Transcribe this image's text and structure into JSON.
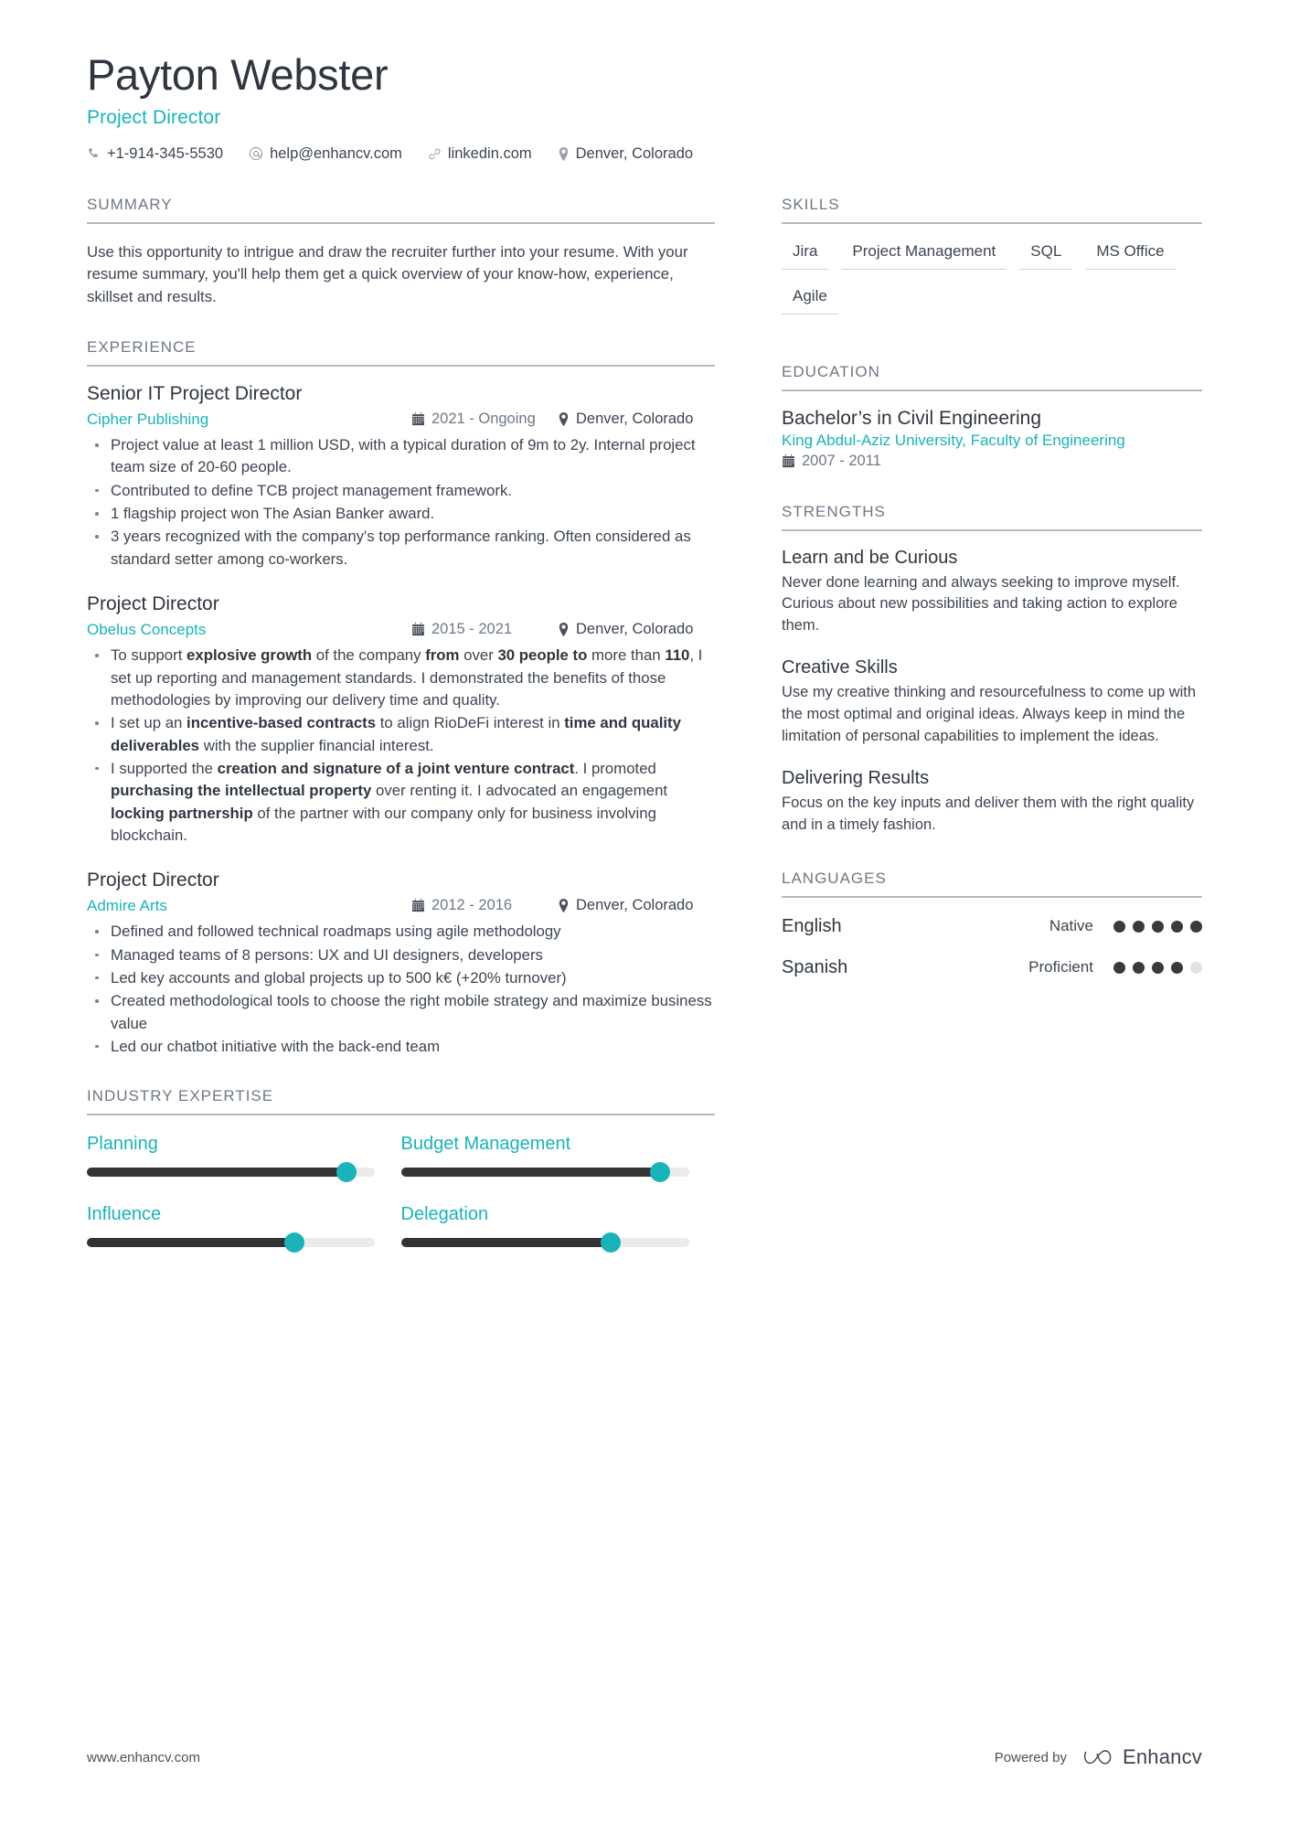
{
  "theme": {
    "accent": "#19b4b9",
    "dark": "#333333",
    "track": "#ebebe9",
    "rule": "#b6b9bd"
  },
  "header": {
    "name": "Payton Webster",
    "role": "Project Director",
    "contacts": [
      {
        "icon": "phone-icon",
        "text": "+1-914-345-5530"
      },
      {
        "icon": "email-icon",
        "text": "help@enhancv.com"
      },
      {
        "icon": "link-icon",
        "text": "linkedin.com"
      },
      {
        "icon": "location-icon",
        "text": "Denver, Colorado"
      }
    ]
  },
  "summary": {
    "heading": "SUMMARY",
    "text": "Use this opportunity to intrigue and draw the recruiter further into your resume. With your resume summary, you'll help them get a quick overview of your know-how, experience, skillset and results."
  },
  "experience": {
    "heading": "EXPERIENCE",
    "items": [
      {
        "title": "Senior IT Project Director",
        "company": "Cipher Publishing",
        "date": "2021 - Ongoing",
        "location": "Denver, Colorado",
        "bullets": [
          "Project value at least 1 million USD, with a typical duration of 9m to 2y. Internal project team size of 20-60 people.",
          "Contributed to define TCB project management framework.",
          "1 flagship project won The Asian Banker award.",
          "3 years recognized with the company's top performance ranking. Often considered as standard setter among co-workers."
        ]
      },
      {
        "title": "Project Director",
        "company": "Obelus Concepts",
        "date": "2015 - 2021",
        "location": "Denver, Colorado",
        "bullets_html": [
          "To support <b>explosive growth</b> of the company <b>from</b> over <b>30 people to</b> more than <b>110</b>, I set up reporting and management standards. I demonstrated the benefits of those methodologies by improving our delivery time and quality.",
          "I set up an <b>incentive-based contracts</b> to align RioDeFi interest in <b>time and quality deliverables</b> with the supplier financial interest.",
          "I supported the <b>creation and signature of a joint venture contract</b>. I promoted <b>purchasing the intellectual property</b> over renting it. I advocated an engagement <b>locking partnership</b> of the partner with our company only for business involving blockchain."
        ]
      },
      {
        "title": "Project Director",
        "company": "Admire Arts",
        "date": "2012 - 2016",
        "location": "Denver, Colorado",
        "bullets": [
          "Defined and followed technical roadmaps using agile methodology",
          "Managed teams of 8 persons: UX and UI designers, developers",
          "Led key accounts and global projects up to 500 k€ (+20% turnover)",
          "Created methodological tools to choose the right mobile strategy and maximize business value",
          "Led our chatbot initiative with the back-end team"
        ]
      }
    ]
  },
  "industry_expertise": {
    "heading": "INDUSTRY EXPERTISE",
    "items": [
      {
        "label": "Planning",
        "value": 90
      },
      {
        "label": "Budget Management",
        "value": 90
      },
      {
        "label": "Influence",
        "value": 72
      },
      {
        "label": "Delegation",
        "value": 73
      }
    ]
  },
  "skills": {
    "heading": "SKILLS",
    "items": [
      "Jira",
      "Project Management",
      "SQL",
      "MS Office",
      "Agile"
    ]
  },
  "education": {
    "heading": "EDUCATION",
    "items": [
      {
        "degree": "Bachelor’s in Civil Engineering",
        "school": "King Abdul-Aziz University, Faculty of Engineering",
        "date": "2007 - 2011"
      }
    ]
  },
  "strengths": {
    "heading": "STRENGTHS",
    "items": [
      {
        "title": "Learn and be Curious",
        "description": "Never done learning and always seeking to improve myself. Curious about new possibilities and taking action to explore them."
      },
      {
        "title": "Creative Skills",
        "description": "Use my creative thinking and resourcefulness to come up with the most optimal and original ideas. Always keep in mind the limitation of personal capabilities to implement the ideas."
      },
      {
        "title": "Delivering Results",
        "description": "Focus on the key inputs and deliver them with the right quality and in a timely fashion."
      }
    ]
  },
  "languages": {
    "heading": "LANGUAGES",
    "items": [
      {
        "name": "English",
        "level": "Native",
        "filled": 5,
        "total": 5
      },
      {
        "name": "Spanish",
        "level": "Proficient",
        "filled": 4,
        "total": 5
      }
    ]
  },
  "footer": {
    "site": "www.enhancv.com",
    "powered_by": "Powered by",
    "brand": "Enhancv"
  }
}
